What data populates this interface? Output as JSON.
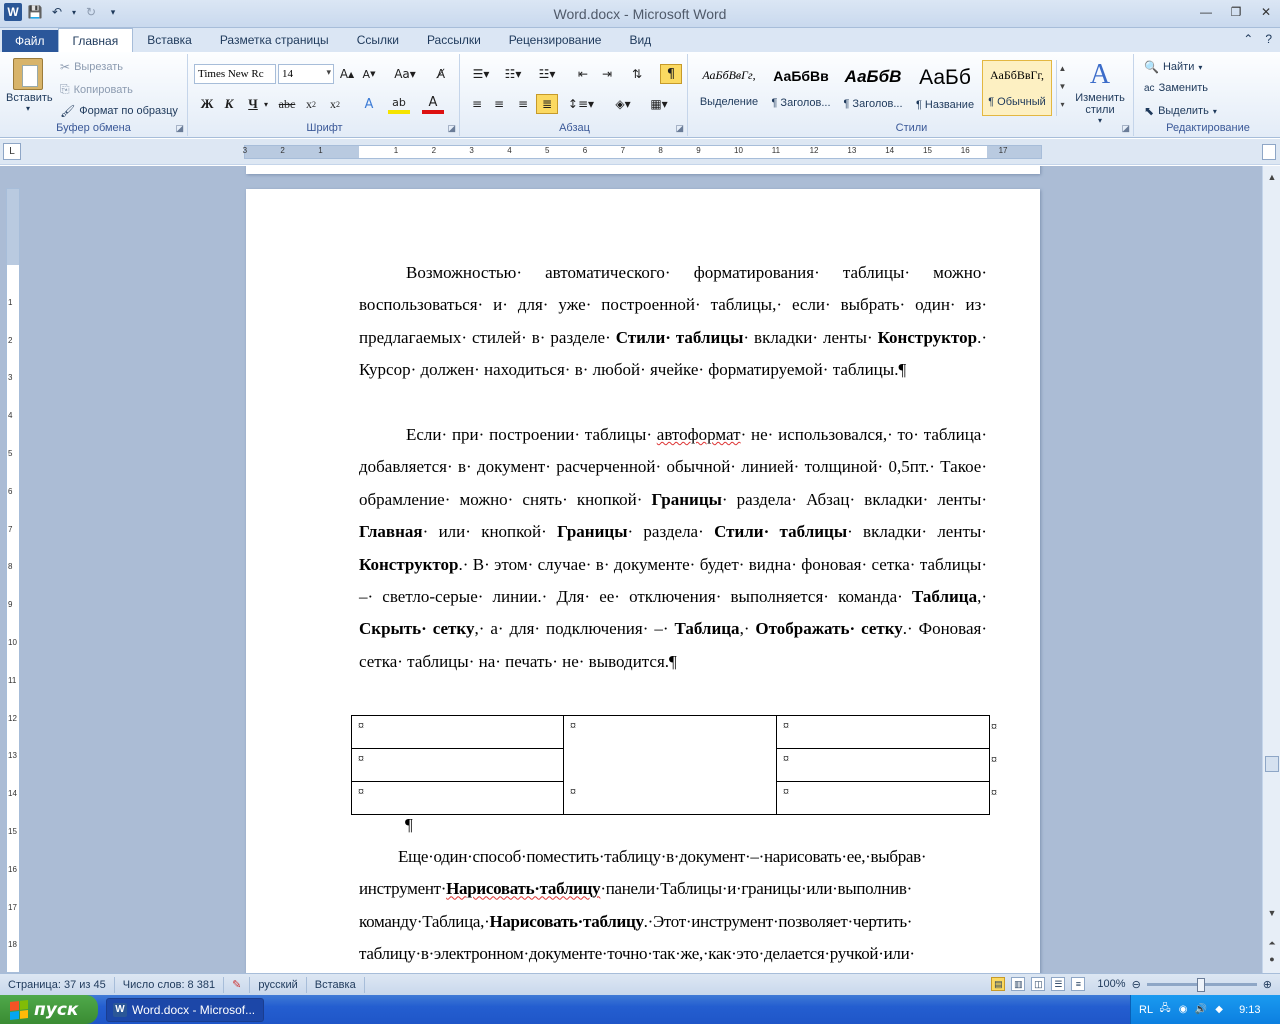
{
  "window": {
    "title": "Word.docx  -  Microsoft Word"
  },
  "tabs": [
    {
      "label": "Файл"
    },
    {
      "label": "Главная"
    },
    {
      "label": "Вставка"
    },
    {
      "label": "Разметка страницы"
    },
    {
      "label": "Ссылки"
    },
    {
      "label": "Рассылки"
    },
    {
      "label": "Рецензирование"
    },
    {
      "label": "Вид"
    }
  ],
  "ribbon": {
    "clipboard": {
      "paste": "Вставить",
      "cut": "Вырезать",
      "copy": "Копировать",
      "format_painter": "Формат по образцу",
      "label": "Буфер обмена"
    },
    "font": {
      "name": "Times New Rc",
      "size": "14",
      "bold": "Ж",
      "italic": "К",
      "underline": "Ч",
      "strike": "abc",
      "label": "Шрифт"
    },
    "paragraph": {
      "label": "Абзац"
    },
    "styles": {
      "items": [
        {
          "sample": "АаБбВвГг,",
          "name": "Выделение"
        },
        {
          "sample": "АаБбВв",
          "name": "¶ Заголов..."
        },
        {
          "sample": "АаБбВ",
          "name": "¶ Заголов..."
        },
        {
          "sample": "АаБб",
          "name": "¶ Название"
        },
        {
          "sample": "АаБбВвГг,",
          "name": "¶ Обычный"
        }
      ],
      "change_styles": "Изменить стили",
      "label": "Стили"
    },
    "editing": {
      "find": "Найти",
      "replace": "Заменить",
      "select": "Выделить",
      "label": "Редактирование"
    }
  },
  "ruler": {
    "h_numbers": [
      "3",
      "2",
      "1",
      "1",
      "2",
      "3",
      "4",
      "5",
      "6",
      "7",
      "8",
      "9",
      "10",
      "11",
      "12",
      "13",
      "14",
      "15",
      "16",
      "17"
    ],
    "v_numbers": [
      "1",
      "2",
      "3",
      "4",
      "5",
      "6",
      "7",
      "8",
      "9",
      "10",
      "11",
      "12",
      "13",
      "14",
      "15",
      "16",
      "17",
      "18"
    ]
  },
  "document": {
    "p1": {
      "a": "Возможностью· автоматического· форматирования· таблицы· можно· воспользоваться· и· для· уже· построенной· таблицы,· если· выбрать· один· из· предлагаемых· стилей· в· разделе· ",
      "b": "Стили· таблицы",
      "c": "· вкладки· ленты· ",
      "d": "Конструктор",
      "e": ".· Курсор· должен· находиться· в· любой· ячейке· форматируемой· таблицы.¶"
    },
    "p2": {
      "a": "Если· при· построении· таблицы· ",
      "sq": "автоформат",
      "b": "· не· использовался,· то· таблица· добавляется· в· документ· расчерченной· обычной· линией· толщиной· 0,5пт.· Такое· обрамление· можно· снять· кнопкой· ",
      "c": "Границы",
      "d": "· раздела· Абзац· вкладки· ленты· ",
      "e": "Главная",
      "f": "· или· кнопкой· ",
      "g": "Границы",
      "h": "· раздела· ",
      "i": "Стили· таблицы",
      "j": "· вкладки· ленты· ",
      "k": "Конструктор",
      "l": ".· В· этом· случае· в· документе· будет· видна· фоновая· сетка· таблицы· –· светло-серые· линии.· Для· ее· отключения· выполняется· команда· ",
      "m": "Таблица",
      "n": ",· ",
      "o": "Скрыть· сетку",
      "p": ",· а· для· подключения· –· ",
      "q": "Таблица",
      "r": ",· ",
      "s": "Отображать· сетку",
      "t": ".· Фоновая· сетка· таблицы· на· печать· не· выводится.¶"
    },
    "cell_mark": "¤",
    "empty_para": "¶",
    "p3": {
      "a": "Еще·один·способ·поместить·таблицу·в·документ·–·нарисовать·ее,·выбрав· инструмент·",
      "b": "Нарисовать·таблицу",
      "c": "·панели·Таблицы·и·границы·или·выполнив· команду·Таблица,·",
      "d": "Нарисовать·таблицу",
      "e": ".·Этот·инструмент·позволяет·чертить· таблицу·в·электронном·документе·точно·так·же,·как·это·делается·ручкой·или·"
    }
  },
  "status": {
    "page": "Страница: 37 из 45",
    "words": "Число слов: 8 381",
    "language": "русский",
    "mode": "Вставка",
    "zoom": "100%"
  },
  "taskbar": {
    "start": "пуск",
    "task": "Word.docx - Microsof...",
    "lang": "RL",
    "time": "9:13"
  }
}
